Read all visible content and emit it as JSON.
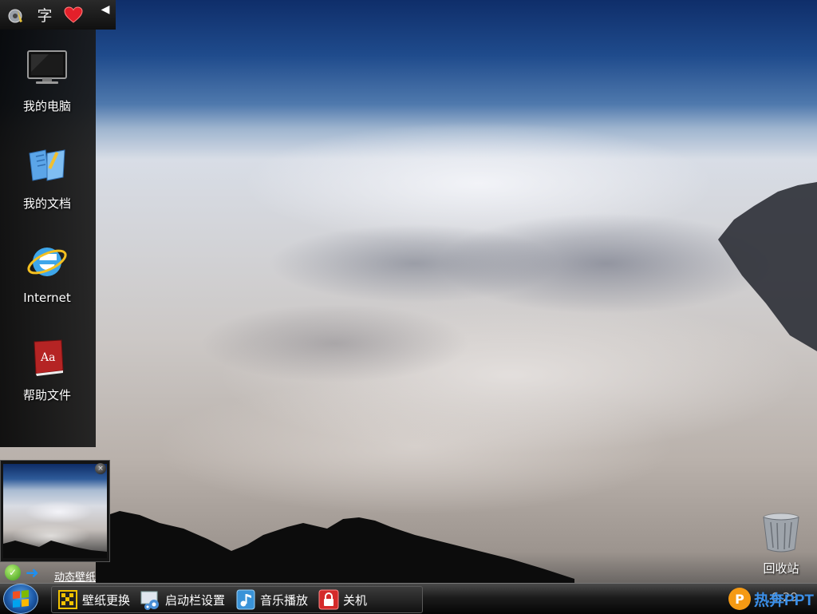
{
  "desktop": {
    "icons": [
      {
        "label": "我的电脑",
        "icon": "monitor-icon"
      },
      {
        "label": "我的文档",
        "icon": "documents-folder-icon"
      },
      {
        "label": "Internet",
        "icon": "internet-explorer-icon"
      },
      {
        "label": "帮助文件",
        "icon": "help-book-icon"
      }
    ],
    "recycle_bin": {
      "label": "回收站",
      "icon": "recycle-bin-icon"
    }
  },
  "panel_top": {
    "icons": [
      "sound-settings-icon",
      "font-icon",
      "favorites-heart-icon"
    ],
    "font_glyph": "字",
    "collapse": "collapse-arrow-icon"
  },
  "live_wallpaper": {
    "link_label": "动态壁纸",
    "close": "×"
  },
  "taskbar": {
    "items": [
      {
        "label": "壁纸更换",
        "icon": "wallpaper-change-icon"
      },
      {
        "label": "启动栏设置",
        "icon": "launchbar-settings-icon"
      },
      {
        "label": "音乐播放",
        "icon": "music-player-icon"
      },
      {
        "label": "关机",
        "icon": "shutdown-lock-icon"
      }
    ],
    "clock": "6:29",
    "brand_badge": "P",
    "brand_text": "热奔PPT"
  },
  "colors": {
    "accent_blue": "#1e8ff0",
    "brand_orange": "#f59a14",
    "brand_blue": "#3b8fe8",
    "heart_red": "#e3202a"
  }
}
